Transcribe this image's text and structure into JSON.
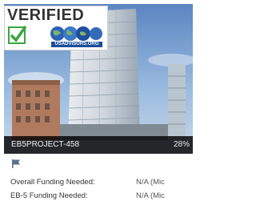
{
  "badge": {
    "title": "VERIFIED",
    "site": "USADVISORS.ORG"
  },
  "project": {
    "id": "EB5PROJECT-458",
    "progress_text": "28%",
    "progress": 0.28
  },
  "details": [
    {
      "label": "Overall Funding Needed:",
      "value": "N/A (Mic"
    },
    {
      "label": "EB-5 Funding Needed:",
      "value": "N/A (Mic"
    }
  ],
  "icons": {
    "check": "check-icon",
    "flag": "flag-icon",
    "globes": "globe-icon"
  },
  "colors": {
    "check": "#3aa540",
    "site_bar": "#1c4e9a",
    "caption_bg": "#111111"
  }
}
